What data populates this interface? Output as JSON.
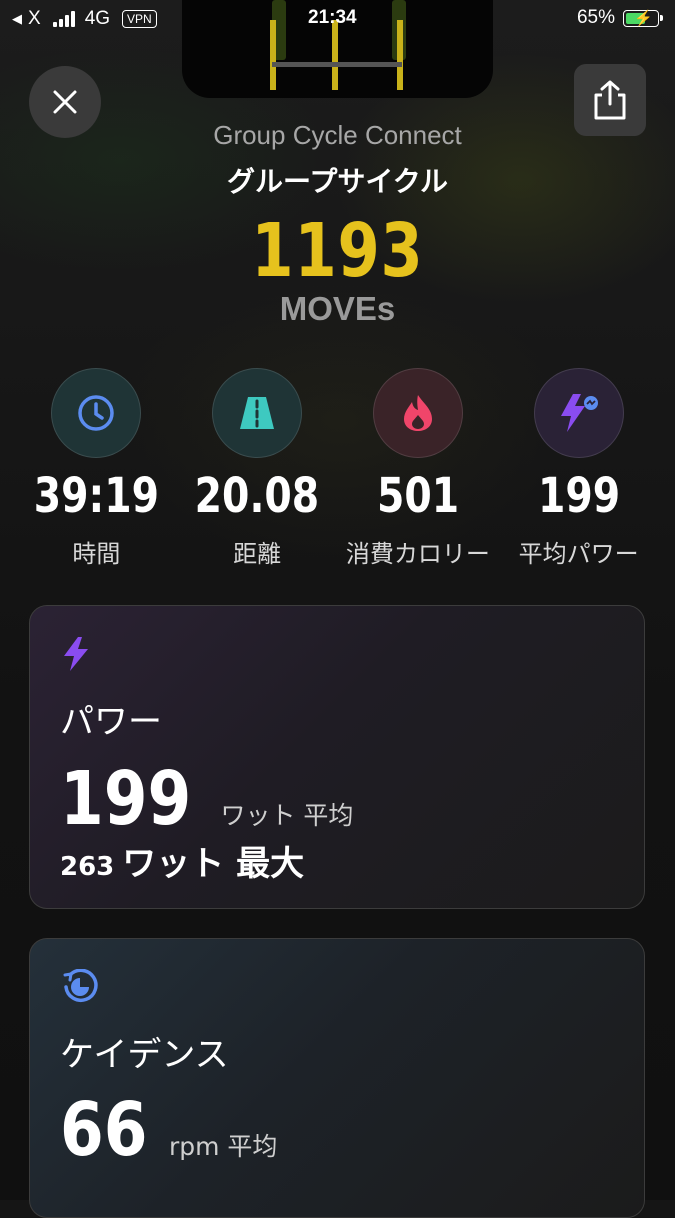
{
  "status_bar": {
    "back_app": "X",
    "network": "4G",
    "vpn": "VPN",
    "time": "21:34",
    "battery_percent": "65%",
    "battery_level": 0.65
  },
  "header": {
    "app_name": "Group Cycle Connect",
    "class_name": "グループサイクル",
    "moves_value": "1193",
    "moves_label": "MOVEs"
  },
  "stats": [
    {
      "icon": "clock-icon",
      "value": "39:19",
      "label": "時間"
    },
    {
      "icon": "road-icon",
      "value": "20.08",
      "label": "距離"
    },
    {
      "icon": "flame-icon",
      "value": "501",
      "label": "消費カロリー"
    },
    {
      "icon": "power-bolt-icon",
      "value": "199",
      "label": "平均パワー"
    }
  ],
  "power_card": {
    "icon": "lightning-icon",
    "title": "パワー",
    "avg_value": "199",
    "avg_unit": "ワット 平均",
    "max_value": "263",
    "max_unit": "ワット 最大"
  },
  "cadence_card": {
    "icon": "cadence-gauge-icon",
    "title": "ケイデンス",
    "avg_value": "66",
    "avg_unit": "rpm 平均"
  },
  "colors": {
    "moves_yellow": "#e6c21d",
    "clock_blue": "#5b8cf0",
    "road_teal": "#3ec9c0",
    "flame_pink": "#f0456a",
    "power_purple": "#8a4cf0"
  }
}
